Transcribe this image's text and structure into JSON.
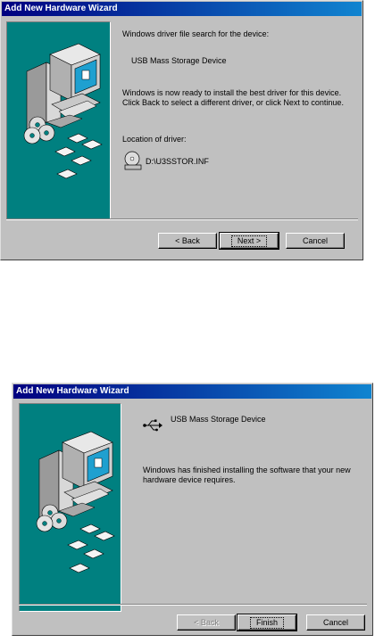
{
  "window1": {
    "title": "Add New Hardware Wizard",
    "search_label": "Windows driver file search for the device:",
    "device_name": "USB Mass Storage Device",
    "ready_message": "Windows is now ready to install the best driver for this device. Click Back to select a different driver, or click Next to continue.",
    "location_label": "Location of driver:",
    "driver_path": "D:\\U3SSTOR.INF",
    "buttons": {
      "back": "< Back",
      "next": "Next >",
      "cancel": "Cancel"
    }
  },
  "window2": {
    "title": "Add New Hardware Wizard",
    "device_name": "USB Mass Storage Device",
    "finish_message": "Windows has finished installing the software that your new hardware device requires.",
    "buttons": {
      "back": "< Back",
      "finish": "Finish",
      "cancel": "Cancel"
    }
  },
  "colors": {
    "titlebar": "#000080",
    "panel": "#008080",
    "face": "#c0c0c0"
  },
  "icons": [
    "computer-illustration",
    "cd-disc-icon",
    "floppy-disk-icon",
    "usb-icon"
  ]
}
